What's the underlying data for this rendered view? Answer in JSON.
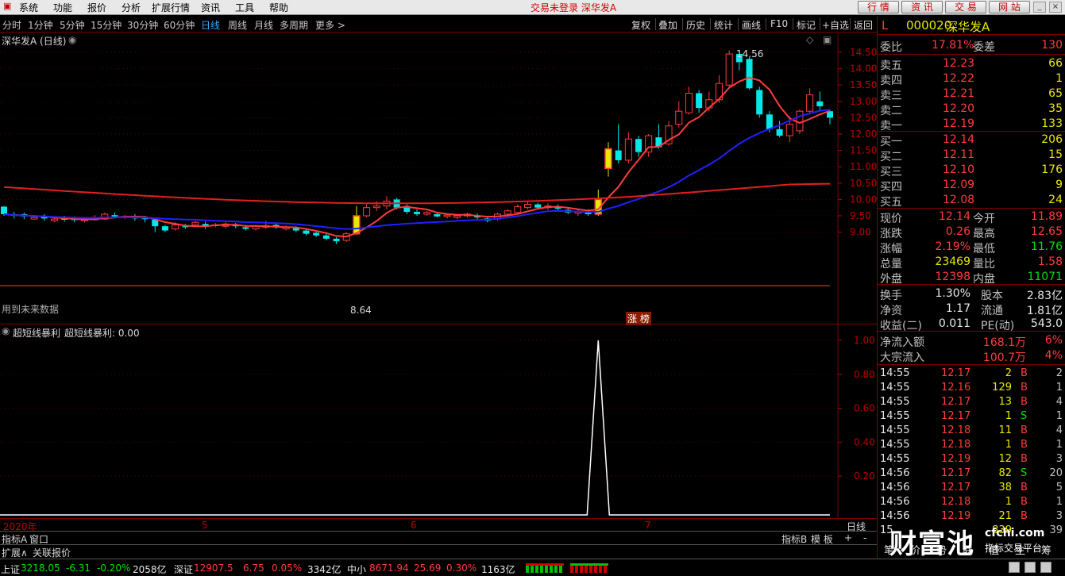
{
  "menubar": {
    "items": [
      "系统",
      "功能",
      "报价",
      "分析",
      "扩展行情",
      "资讯",
      "工具",
      "帮助"
    ],
    "center_text": "交易未登录  深华发A",
    "tabs": [
      "行 情",
      "资 讯",
      "交 易",
      "网 站"
    ]
  },
  "periodbar": {
    "periods": [
      "分时",
      "1分钟",
      "5分钟",
      "15分钟",
      "30分钟",
      "60分钟",
      "日线",
      "周线",
      "月线",
      "多周期",
      "更多 >"
    ],
    "active": "日线",
    "tools": [
      "复权",
      "叠加",
      "历史",
      "统计",
      "画线",
      "F10",
      "标记",
      "+自选",
      "返回"
    ]
  },
  "kchart": {
    "title": "深华发A (日线)",
    "future_note": "用到未来数据",
    "high_label": "14.56",
    "low_label": "8.64",
    "badge": "涨 榜",
    "yticks": [
      "14.50",
      "14.00",
      "13.50",
      "13.00",
      "12.50",
      "12.00",
      "11.50",
      "11.00",
      "10.50",
      "10.00",
      "9.50",
      "9.00"
    ],
    "colors": {
      "up": "#ff3c3c",
      "down": "#00e8e8",
      "ma1": "#ff3c3c",
      "ma2": "#2020ff",
      "ma3": "#e02020"
    }
  },
  "indicator": {
    "title": "超短线暴利",
    "value_label": "超短线暴利: 0.00",
    "yticks": [
      "1.00",
      "0.80",
      "0.60",
      "0.40",
      "0.20"
    ],
    "spike_value": 1.0
  },
  "xaxis": {
    "labels": [
      "2020年",
      "5",
      "6",
      "7"
    ],
    "right": "日线"
  },
  "tabs": {
    "row1": [
      "指标A",
      "窗口"
    ],
    "row1_right": [
      "指标B",
      "模 板",
      "+",
      "-"
    ],
    "row2": [
      "扩展∧",
      "关联报价"
    ]
  },
  "quote": {
    "code": "000020",
    "name": "深华发A",
    "flag": "L",
    "weibi": {
      "label": "委比",
      "value": "17.81%",
      "label2": "委差",
      "value2": "130"
    },
    "sells": [
      {
        "label": "卖五",
        "price": "12.23",
        "vol": "66"
      },
      {
        "label": "卖四",
        "price": "12.22",
        "vol": "1"
      },
      {
        "label": "卖三",
        "price": "12.21",
        "vol": "65"
      },
      {
        "label": "卖二",
        "price": "12.20",
        "vol": "35"
      },
      {
        "label": "卖一",
        "price": "12.19",
        "vol": "133"
      }
    ],
    "buys": [
      {
        "label": "买一",
        "price": "12.14",
        "vol": "206"
      },
      {
        "label": "买二",
        "price": "12.11",
        "vol": "15"
      },
      {
        "label": "买三",
        "price": "12.10",
        "vol": "176"
      },
      {
        "label": "买四",
        "price": "12.09",
        "vol": "9"
      },
      {
        "label": "买五",
        "price": "12.08",
        "vol": "24"
      }
    ],
    "stats": [
      {
        "l1": "现价",
        "v1": "12.14",
        "l2": "今开",
        "v2": "11.89",
        "c1": "red",
        "c2": "red"
      },
      {
        "l1": "涨跌",
        "v1": "0.26",
        "l2": "最高",
        "v2": "12.65",
        "c1": "red",
        "c2": "red"
      },
      {
        "l1": "涨幅",
        "v1": "2.19%",
        "l2": "最低",
        "v2": "11.76",
        "c1": "red",
        "c2": "grn"
      },
      {
        "l1": "总量",
        "v1": "23469",
        "l2": "量比",
        "v2": "1.58",
        "c1": "yl",
        "c2": "red"
      },
      {
        "l1": "外盘",
        "v1": "12398",
        "l2": "内盘",
        "v2": "11071",
        "c1": "red",
        "c2": "grn"
      }
    ],
    "stats2": [
      {
        "l1": "换手",
        "v1": "1.30%",
        "l2": "股本",
        "v2": "2.83亿"
      },
      {
        "l1": "净资",
        "v1": "1.17",
        "l2": "流通",
        "v2": "1.81亿"
      },
      {
        "l1": "收益(二)",
        "v1": "0.011",
        "l2": "PE(动)",
        "v2": "543.0"
      }
    ],
    "flows": [
      {
        "label": "净流入额",
        "value": "168.1万",
        "pct": "6%"
      },
      {
        "label": "大宗流入",
        "value": "100.7万",
        "pct": "4%"
      }
    ],
    "ticks": [
      {
        "t": "14:55",
        "p": "12.17",
        "v": "2",
        "bs": "B",
        "n": "2"
      },
      {
        "t": "14:55",
        "p": "12.16",
        "v": "129",
        "bs": "B",
        "n": "1"
      },
      {
        "t": "14:55",
        "p": "12.17",
        "v": "13",
        "bs": "B",
        "n": "4"
      },
      {
        "t": "14:55",
        "p": "12.17",
        "v": "1",
        "bs": "S",
        "n": "1"
      },
      {
        "t": "14:55",
        "p": "12.18",
        "v": "11",
        "bs": "B",
        "n": "4"
      },
      {
        "t": "14:55",
        "p": "12.18",
        "v": "1",
        "bs": "B",
        "n": "1"
      },
      {
        "t": "14:55",
        "p": "12.19",
        "v": "12",
        "bs": "B",
        "n": "3"
      },
      {
        "t": "14:56",
        "p": "12.17",
        "v": "82",
        "bs": "S",
        "n": "20"
      },
      {
        "t": "14:56",
        "p": "12.17",
        "v": "38",
        "bs": "B",
        "n": "5"
      },
      {
        "t": "14:56",
        "p": "12.18",
        "v": "1",
        "bs": "B",
        "n": "1"
      },
      {
        "t": "14:56",
        "p": "12.19",
        "v": "21",
        "bs": "B",
        "n": "3"
      },
      {
        "t": "15",
        "p": "",
        "v": "839",
        "bs": "",
        "n": "39"
      }
    ],
    "bottom_tabs": [
      "笔",
      "价",
      "势",
      "联",
      "值",
      "主",
      "筹"
    ]
  },
  "statusbar": {
    "sh": {
      "name": "上证",
      "idx": "3218.05",
      "chg": "-6.31",
      "pct": "-0.20%",
      "amt": "2058亿"
    },
    "sz": {
      "name": "深证",
      "idx": "12907.5",
      "chg": "6.75",
      "pct": "0.05%",
      "amt": "3342亿"
    },
    "zx": {
      "name": "中小",
      "idx": "8671.94",
      "chg": "25.69",
      "pct": "0.30%",
      "amt": "1163亿"
    }
  },
  "watermark": {
    "brand": "财富池",
    "site": "cfchi.com",
    "sub": "指标交易平台"
  }
}
